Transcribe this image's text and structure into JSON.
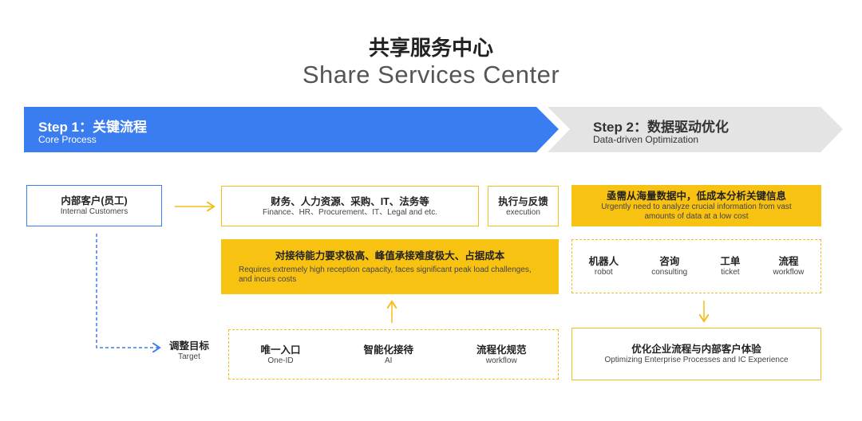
{
  "header": {
    "title_cn": "共享服务中心",
    "title_en": "Share Services Center"
  },
  "steps": [
    {
      "title": "Step 1：关键流程",
      "subtitle": "Core Process"
    },
    {
      "title": "Step 2：数据驱动优化",
      "subtitle": "Data-driven Optimization"
    }
  ],
  "internal_customers": {
    "cn": "内部客户(员工)",
    "en": "Internal Customers"
  },
  "services": {
    "cn": "财务、人力资源、采购、IT、法务等",
    "en": "Finance、HR、Procurement、IT、Legal and etc."
  },
  "execution": {
    "cn": "执行与反馈",
    "en": "execution"
  },
  "challenge": {
    "cn": "对接待能力要求极高、峰值承接难度极大、占据成本",
    "en": "Requires extremely high reception capacity, faces significant peak load challenges, and incurs costs"
  },
  "target": {
    "cn": "调整目标",
    "en": "Target"
  },
  "target_items": [
    {
      "cn": "唯一入口",
      "en": "One-ID"
    },
    {
      "cn": "智能化接待",
      "en": "AI"
    },
    {
      "cn": "流程化规范",
      "en": "workflow"
    }
  ],
  "urgent": {
    "cn": "亟需从海量数据中，低成本分析关键信息",
    "en": "Urgently need to analyze crucial information from vast amounts of data at a low cost"
  },
  "tools": [
    {
      "cn": "机器人",
      "en": "robot"
    },
    {
      "cn": "咨询",
      "en": "consulting"
    },
    {
      "cn": "工单",
      "en": "ticket"
    },
    {
      "cn": "流程",
      "en": "workflow"
    }
  ],
  "optimize": {
    "cn": "优化企业流程与内部客户体验",
    "en": "Optimizing Enterprise Processes and IC Experience"
  },
  "colors": {
    "blue": "#3a7df0",
    "yellow": "#f8c212",
    "gray": "#e4e4e4"
  }
}
